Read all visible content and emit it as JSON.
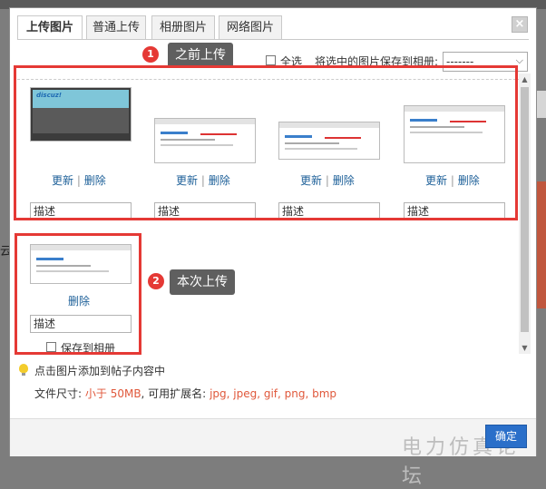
{
  "background": {
    "left_char": "云"
  },
  "tabs": [
    {
      "label": "上传图片",
      "active": true
    },
    {
      "label": "普通上传",
      "active": false
    },
    {
      "label": "相册图片",
      "active": false
    },
    {
      "label": "网络图片",
      "active": false
    }
  ],
  "close_label": "×",
  "toolbar": {
    "select_all": "全选",
    "save_to_album": "将选中的图片保存到相册:",
    "album_value": "-------",
    "arrow": "⌵"
  },
  "annotations": [
    {
      "number": "1",
      "text": "之前上传"
    },
    {
      "number": "2",
      "text": "本次上传"
    }
  ],
  "previous_items": [
    {
      "update": "更新",
      "sep": "|",
      "delete": "删除",
      "desc": "描述",
      "thumb_logo": "discuz!"
    },
    {
      "update": "更新",
      "sep": "|",
      "delete": "删除",
      "desc": "描述"
    },
    {
      "update": "更新",
      "sep": "|",
      "delete": "删除",
      "desc": "描述"
    },
    {
      "update": "更新",
      "sep": "|",
      "delete": "删除",
      "desc": "描述"
    }
  ],
  "current_item": {
    "delete": "删除",
    "desc": "描述",
    "save_to_album": "保存到相册"
  },
  "hint": {
    "text": "点击图片添加到帖子内容中"
  },
  "rules": {
    "size_label": "文件尺寸:",
    "size_value": "小于 50MB",
    "ext_label": ", 可用扩展名:",
    "ext_value": "jpg, jpeg, gif, png, bmp"
  },
  "confirm_label": "确定",
  "watermark": "电力仿真论坛",
  "colors": {
    "annotation_red": "#e53935",
    "link_blue": "#1c5f98",
    "highlight_orange": "#e0583b",
    "button_blue": "#2a6fc9"
  }
}
